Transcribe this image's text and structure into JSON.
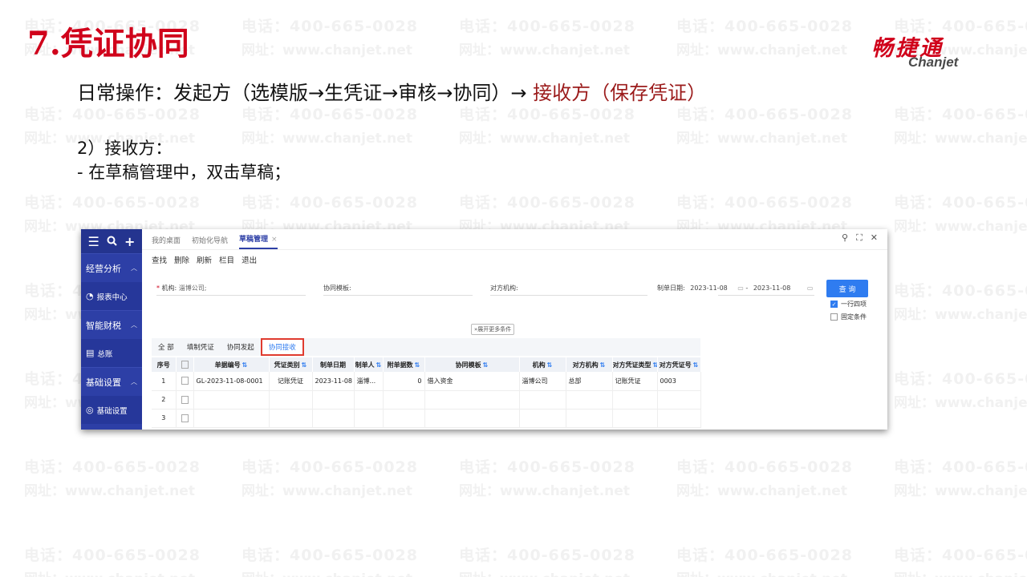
{
  "watermark": {
    "phone": "电话：400-665-0028",
    "site": "网址：www.chanjet.net"
  },
  "slide": {
    "title": "7.凭证协同",
    "logo_cn": "畅捷通",
    "logo_en": "Chanjet",
    "intro_prefix": "日常操作：发起方（选模版→生凭证→审核→协同）→ ",
    "intro_highlight": "接收方（保存凭证）",
    "step_title": "2）接收方：",
    "step_detail": "- 在草稿管理中，双击草稿；",
    "highlight_color": "#9b1b1b",
    "title_color": "#d0021b"
  },
  "app": {
    "sidebar": {
      "top_icons": [
        "menu-icon",
        "search-icon",
        "plus-icon"
      ],
      "sections": [
        {
          "label": "经营分析",
          "item": "报表中心",
          "item_icon": "report-icon"
        },
        {
          "label": "智能财税",
          "item": "总账",
          "item_icon": "ledger-icon"
        },
        {
          "label": "基础设置",
          "item": "基础设置",
          "item_icon": "settings-icon"
        }
      ]
    },
    "tabs": [
      "我的桌面",
      "初始化导航",
      "草稿管理"
    ],
    "active_tab": "草稿管理",
    "toolbar": [
      "查找",
      "删除",
      "刷新",
      "栏目",
      "退出"
    ],
    "filters": {
      "org_label": "机构:",
      "org_value": "淄博公司;",
      "template_label": "协同模板:",
      "counterparty_label": "对方机构:",
      "date_label": "制单日期:",
      "date_from": "2023-11-08",
      "date_sep": "-",
      "date_to": "2023-11-08",
      "query_button": "查 询",
      "one_row": "一行四项",
      "one_row_checked": true,
      "fixed": "固定条件",
      "fixed_checked": false,
      "expand": "展开更多条件"
    },
    "subtabs": [
      "全 部",
      "填制凭证",
      "协同发起",
      "协同接收"
    ],
    "selected_subtab": "协同接收",
    "table": {
      "headers": [
        "序号",
        "",
        "单据编号",
        "凭证类别",
        "制单日期",
        "制单人",
        "附单据数",
        "协同模板",
        "机构",
        "对方机构",
        "对方凭证类型",
        "对方凭证号"
      ],
      "rows": [
        [
          "1",
          "",
          "GL-2023-11-08-0001",
          "记账凭证",
          "2023-11-08",
          "淄博...",
          "0",
          "借入资金",
          "淄博公司",
          "总部",
          "记账凭证",
          "0003"
        ],
        [
          "2",
          "",
          "",
          "",
          "",
          "",
          "",
          "",
          "",
          "",
          "",
          ""
        ],
        [
          "3",
          "",
          "",
          "",
          "",
          "",
          "",
          "",
          "",
          "",
          "",
          ""
        ]
      ]
    },
    "accent": "#2d3fa6",
    "button_color": "#2f7cf0"
  }
}
